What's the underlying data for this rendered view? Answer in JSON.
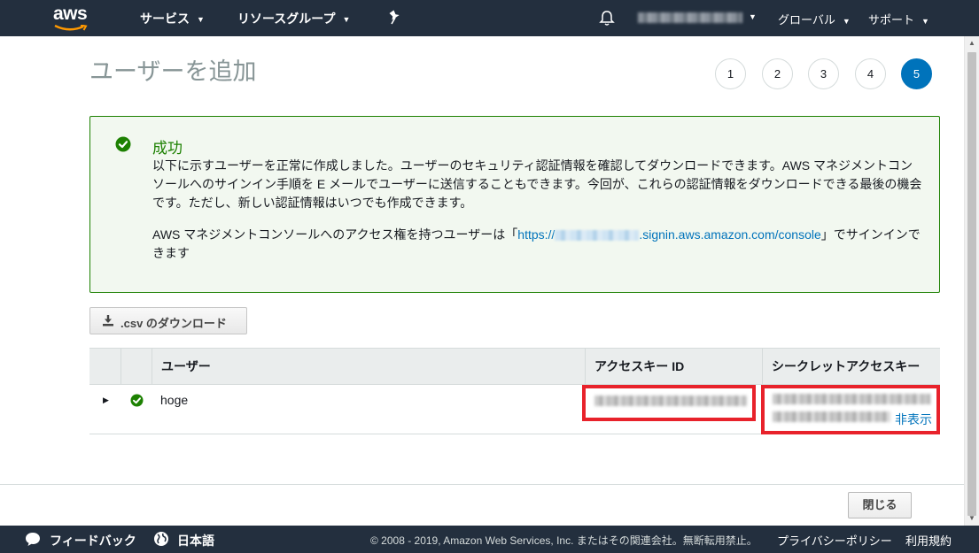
{
  "topnav": {
    "logo_text": "aws",
    "services": "サービス",
    "resource_groups": "リソースグループ",
    "region": "グローバル",
    "support": "サポート"
  },
  "page": {
    "title": "ユーザーを追加",
    "steps": [
      "1",
      "2",
      "3",
      "4",
      "5"
    ],
    "active_step": "5"
  },
  "success": {
    "title": "成功",
    "message": "以下に示すユーザーを正常に作成しました。ユーザーのセキュリティ認証情報を確認してダウンロードできます。AWS マネジメントコンソールへのサインイン手順を E メールでユーザーに送信することもできます。今回が、これらの認証情報をダウンロードできる最後の機会です。ただし、新しい認証情報はいつでも作成できます。",
    "signin_prefix": "AWS マネジメントコンソールへのアクセス権を持つユーザーは「",
    "signin_url_start": "https://",
    "signin_url_end": ".signin.aws.amazon.com/console",
    "signin_suffix": "」でサインインできます"
  },
  "download_button": ".csv のダウンロード",
  "table": {
    "headers": [
      "ユーザー",
      "アクセスキー ID",
      "シークレットアクセスキー"
    ],
    "rows": [
      {
        "user": "hoge",
        "hide_label": "非表示"
      }
    ]
  },
  "close_button": "閉じる",
  "footer": {
    "feedback": "フィードバック",
    "language": "日本語",
    "copyright": "© 2008 - 2019, Amazon Web Services, Inc. またはその関連会社。無断転用禁止。",
    "privacy": "プライバシーポリシー",
    "terms": "利用規約"
  },
  "colors": {
    "nav_bg": "#232f3e",
    "accent": "#0073bb",
    "success": "#1d8102",
    "highlight": "#e8222b"
  }
}
